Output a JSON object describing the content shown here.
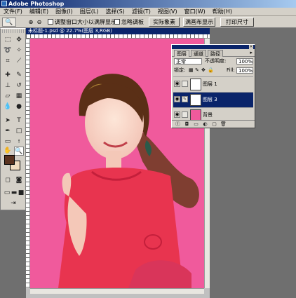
{
  "app": {
    "title": "Adobe Photoshop"
  },
  "menu": [
    "文件(F)",
    "编辑(E)",
    "图像(I)",
    "图层(L)",
    "选择(S)",
    "滤镜(T)",
    "视图(V)",
    "窗口(W)",
    "帮助(H)"
  ],
  "options": {
    "tool_icon": "🔍",
    "zoom_in": "⊕",
    "zoom_out": "⊖",
    "resize_window": "调整窗口大小以满屏显示",
    "ignore_palettes": "忽略调板",
    "actual_pixels": "实际象素",
    "fit_screen": "满画布显示",
    "print_size": "打印尺寸"
  },
  "document": {
    "title": "未标题-1.psd @ 22.7%(图层 3,RGB)"
  },
  "layers_panel": {
    "tabs": [
      "图层",
      "通道",
      "路径"
    ],
    "menu_icon": "▸",
    "blend_mode": "正常",
    "opacity_label": "不透明度:",
    "opacity_value": "100%",
    "lock_label": "锁定:",
    "fill_label": "Fill:",
    "fill_value": "100%",
    "layers": [
      {
        "name": "图层 1",
        "selected": false
      },
      {
        "name": "图层 3",
        "selected": true
      },
      {
        "name": "背景",
        "selected": false
      }
    ]
  },
  "colors": {
    "canvas_bg": "#f05a9c",
    "foreground": "#5a3320",
    "background": "#f0dcc0",
    "selection": "#0a246a"
  }
}
